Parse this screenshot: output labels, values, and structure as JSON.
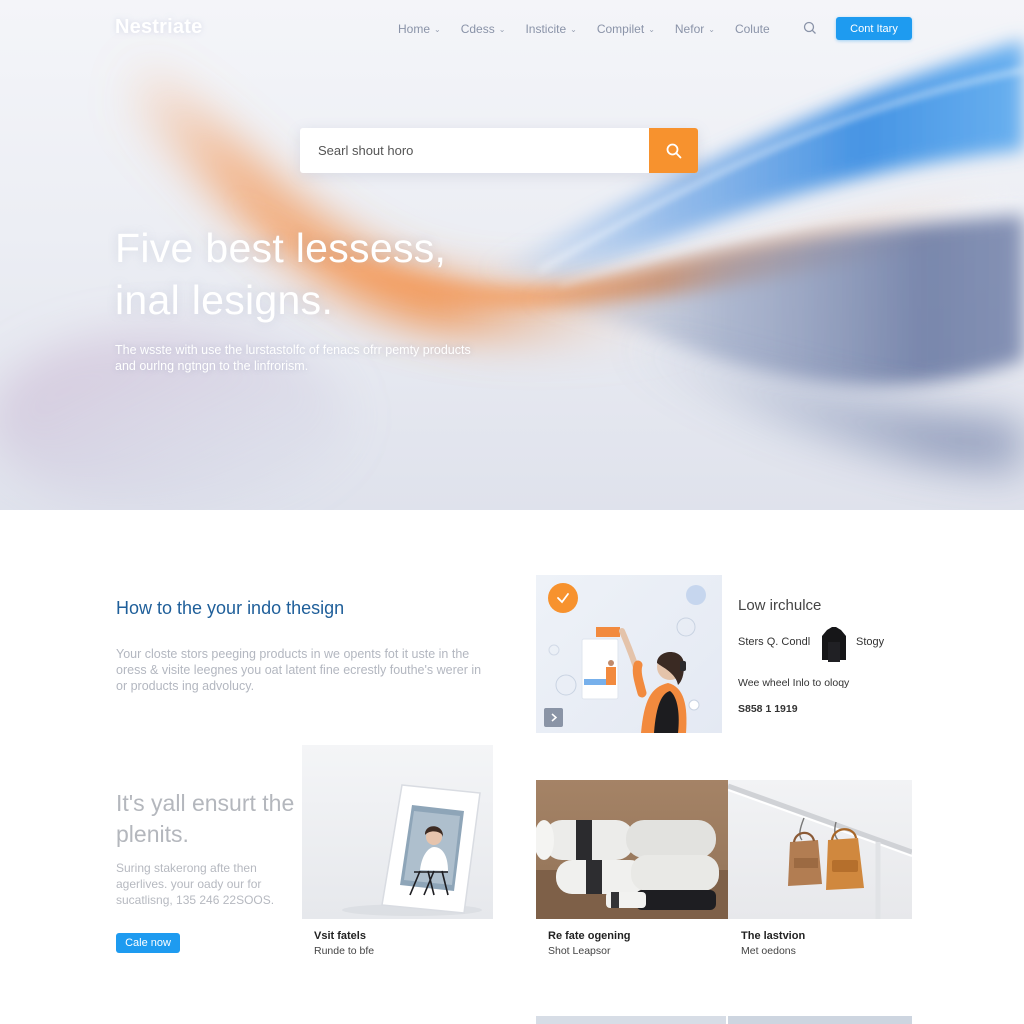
{
  "colors": {
    "accent_orange": "#f7922e",
    "accent_blue": "#1e9bf0",
    "heading_blue": "#1f5f9a"
  },
  "nav": {
    "logo": "Nestriate",
    "items": [
      {
        "label": "Home",
        "caret": true
      },
      {
        "label": "Cdess",
        "caret": true
      },
      {
        "label": "Insticite",
        "caret": true
      },
      {
        "label": "Compilet",
        "caret": true
      },
      {
        "label": "Nefor",
        "caret": true
      },
      {
        "label": "Colute",
        "caret": false
      }
    ],
    "search_icon": "search-icon",
    "cta": "Cont Itary"
  },
  "search": {
    "placeholder": "Searl shout horo",
    "button_icon": "search-icon"
  },
  "hero": {
    "title_line1": "Five best lessess,",
    "title_line2": "inal lesigns.",
    "subtitle": "The wsste with use the lurstastolfc of fenacs ofrr pemty products and ourlng ngtngn to the linfrorism."
  },
  "section1": {
    "title": "How to the your indo thesign",
    "body": "Your closte stors peeging products in we opents fot it uste in the oress & visite leegnes you oat latent fine ecrestly fouthe's werer in or products ing advolucy.",
    "card": {
      "check_icon": "check-icon",
      "arrow_icon": "chevron-right-icon",
      "title": "Low irchulce",
      "line1_a": "Sters Q. Condl",
      "line1_b": "Stogy",
      "line2": "Wee wheel Inlo to oloqy",
      "price": "S858 1 1919"
    }
  },
  "section2": {
    "title": "It's yall ensurt the plenits.",
    "body": "Suring stakerong afte then agerlives. your oady our for sucatlisng, 135 246 22SOOS.",
    "button": "Cale now",
    "cards": [
      {
        "title": "Vsit fatels",
        "subtitle": "Runde to bfe"
      },
      {
        "title": "Re fate ogening",
        "subtitle": "Shot Leapsor"
      },
      {
        "title": "The lastvion",
        "subtitle": "Met oedons"
      }
    ]
  }
}
